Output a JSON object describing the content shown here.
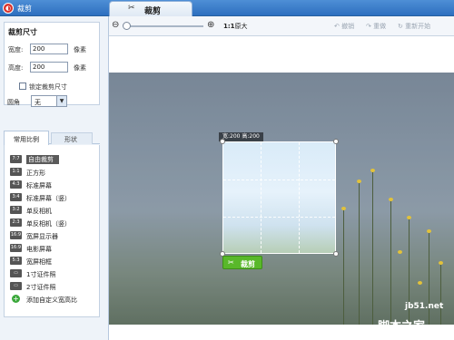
{
  "titlebar": {
    "app_title": "裁剪",
    "logo_letter": "◐"
  },
  "tabs": [
    {
      "label": "裁剪",
      "icon": "scissors-icon",
      "icon_glyph": "✂"
    }
  ],
  "crop_size": {
    "title": "裁剪尺寸",
    "width_label": "宽度:",
    "width_value": "200",
    "height_label": "高度:",
    "height_value": "200",
    "unit": "像素",
    "lock_label": "锁定裁剪尺寸",
    "lock_checked": false
  },
  "corner": {
    "label": "圆角",
    "value": "无",
    "arrow": "▼"
  },
  "ratio_tabs": {
    "common": "常用比例",
    "shape": "形状"
  },
  "ratio_items": [
    {
      "icon": "7:7",
      "label": "自由裁剪",
      "selected": true
    },
    {
      "icon": "1:1",
      "label": "正方形"
    },
    {
      "icon": "4:3",
      "label": "标准屏幕"
    },
    {
      "icon": "3:4",
      "label": "标准屏幕（竖）"
    },
    {
      "icon": "3:2",
      "label": "单反相机"
    },
    {
      "icon": "2:3",
      "label": "单反相机（竖）"
    },
    {
      "icon": "16:9",
      "label": "宽屏显示器"
    },
    {
      "icon": "16:9",
      "label": "电影屏幕"
    },
    {
      "icon": "5:3",
      "label": "宽屏相框"
    },
    {
      "icon": "▭",
      "label": "1寸证件照"
    },
    {
      "icon": "▭",
      "label": "2寸证件照"
    },
    {
      "icon": "+",
      "label": "添加自定义宽高比"
    }
  ],
  "toolbar": {
    "zoom_out": "⊖",
    "zoom_in": "⊕",
    "ratio_label_bold": "1:1",
    "ratio_label_rest": "原大",
    "undo": "↶ 撤销",
    "redo": "↷ 重做",
    "restart": "↻ 重新开始",
    "zoom_level": 0.0
  },
  "crop_overlay": {
    "readout": "宽:200  高:200",
    "button_label": "裁剪",
    "button_icon": "✂"
  },
  "watermark": {
    "site": "jb51.net",
    "text": "脚本之家"
  }
}
